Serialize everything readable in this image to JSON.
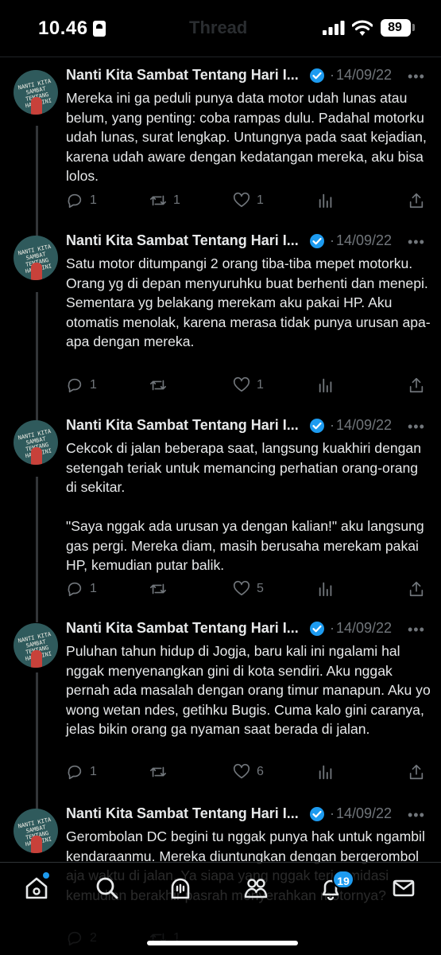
{
  "status_bar": {
    "time": "10.46",
    "battery": "89",
    "faded_title": "Thread"
  },
  "author": {
    "name": "Nanti Kita Sambat Tentang Hari I...",
    "avatar_text": "NANTI KITA SAMBAT TENTANG HARI INI"
  },
  "tweets": [
    {
      "date": "14/09/22",
      "text": "Mereka ini ga peduli punya data motor udah lunas atau belum, yang penting: coba rampas dulu. Padahal motorku udah lunas, surat lengkap. Untungnya pada saat kejadian, karena udah aware dengan kedatangan mereka, aku bisa lolos.",
      "replies": "1",
      "retweets": "1",
      "likes": "1"
    },
    {
      "date": "14/09/22",
      "text": "Satu motor ditumpangi 2 orang tiba-tiba mepet motorku. Orang yg di depan menyuruhku buat berhenti dan menepi. Sementara yg belakang merekam aku pakai HP. Aku otomatis menolak, karena merasa tidak punya urusan apa-apa dengan mereka.",
      "replies": "1",
      "retweets": "",
      "likes": "1"
    },
    {
      "date": "14/09/22",
      "text": "Cekcok di jalan beberapa saat, langsung kuakhiri dengan setengah teriak untuk memancing perhatian orang-orang di sekitar.\n\n\"Saya nggak ada urusan ya dengan kalian!\" aku langsung gas pergi. Mereka diam, masih berusaha merekam pakai HP, kemudian putar balik.",
      "replies": "1",
      "retweets": "",
      "likes": "5"
    },
    {
      "date": "14/09/22",
      "text": "Puluhan tahun hidup di Jogja, baru kali ini ngalami hal nggak menyenangkan gini di kota sendiri. Aku nggak pernah ada masalah dengan orang timur manapun. Aku yo wong wetan ndes, getihku Bugis. Cuma kalo gini caranya, jelas bikin orang ga nyaman saat berada di jalan.",
      "replies": "1",
      "retweets": "",
      "likes": "6"
    },
    {
      "date": "14/09/22",
      "text": "Gerombolan DC begini tu nggak punya hak untuk ngambil kendaraanmu. Mereka diuntungkan dengan bergerombol aja waktu di jalan. Ya siapa yang nggak terintimidasi kemudian berakhir pasrah menyerahkan motornya?",
      "replies": "2",
      "retweets": "1",
      "likes": ""
    }
  ],
  "tab_bar": {
    "notifications_count": "19"
  },
  "colors": {
    "background": "#000000",
    "text": "#e7e9ea",
    "muted": "#71767b",
    "accent": "#1d9bf0"
  }
}
